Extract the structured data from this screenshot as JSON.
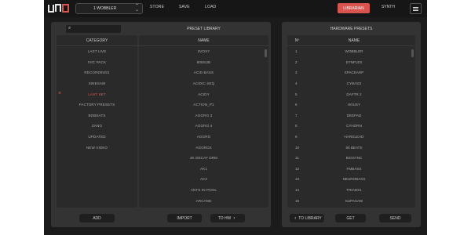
{
  "topbar": {
    "preset_select": "1 WOBBLER",
    "store": "STORE",
    "save": "SAVE",
    "load": "LOAD",
    "librarian": "LIBRARIAN",
    "synth": "SYNTH"
  },
  "preset_panel": {
    "title": "PRESET LIBRARY",
    "category_header": "CATEGORY",
    "name_header": "NAME",
    "categories": [
      "LAST LIVE",
      "IVIC PACK",
      "RECORDINGS",
      "SINESAW",
      "LAST SET",
      "FACTORY PRESETS",
      "BOBEATS",
      "ZANO",
      "UPDATED",
      "NEW VIDEO"
    ],
    "active_category": "LAST SET",
    "names": [
      "3VOXY",
      "808SUB",
      "ACID BASS",
      "ACIDIC SEQ",
      "ACIDY",
      "ACTION_P1",
      "AGGRO 3",
      "AGGRO 4",
      "AGGRO",
      "AGGRO2",
      "4K DECAY DRM",
      "AK1",
      "AK2",
      "ANTS IN POOL",
      "ARCANE"
    ],
    "add": "ADD",
    "import": "IMPORT",
    "to_hw": "TO HW"
  },
  "hw_panel": {
    "title": "HARDWARE PRESETS",
    "num_header": "Nº",
    "name_header": "NAME",
    "rows": [
      {
        "n": "1",
        "name": "WOBBLER"
      },
      {
        "n": "2",
        "name": "SYNFLEX"
      },
      {
        "n": "3",
        "name": "SPACEARP"
      },
      {
        "n": "4",
        "name": "CYBASS"
      },
      {
        "n": "5",
        "name": "DAFTR 2"
      },
      {
        "n": "6",
        "name": "HOUSY"
      },
      {
        "n": "7",
        "name": "DEEPAD"
      },
      {
        "n": "8",
        "name": "CYHORN"
      },
      {
        "n": "9",
        "name": "HARDLEAD"
      },
      {
        "n": "10",
        "name": "80 BEATS"
      },
      {
        "n": "11",
        "name": "BIGSYNC"
      },
      {
        "n": "12",
        "name": "FMBASS"
      },
      {
        "n": "13",
        "name": "NEUROBASS"
      },
      {
        "n": "14",
        "name": "TRIADS1"
      },
      {
        "n": "15",
        "name": "SUPASAW"
      }
    ],
    "to_library": "TO LIBRARY",
    "get": "GET",
    "send": "SEND"
  },
  "colors": {
    "accent": "#d9534f",
    "panel": "#333333",
    "background": "#1b1b1b"
  },
  "icons": [
    "logo",
    "chevron-updown-icon",
    "hamburger-menu-icon",
    "search-icon",
    "close-icon",
    "chevron-left-icon",
    "chevron-right-icon"
  ]
}
